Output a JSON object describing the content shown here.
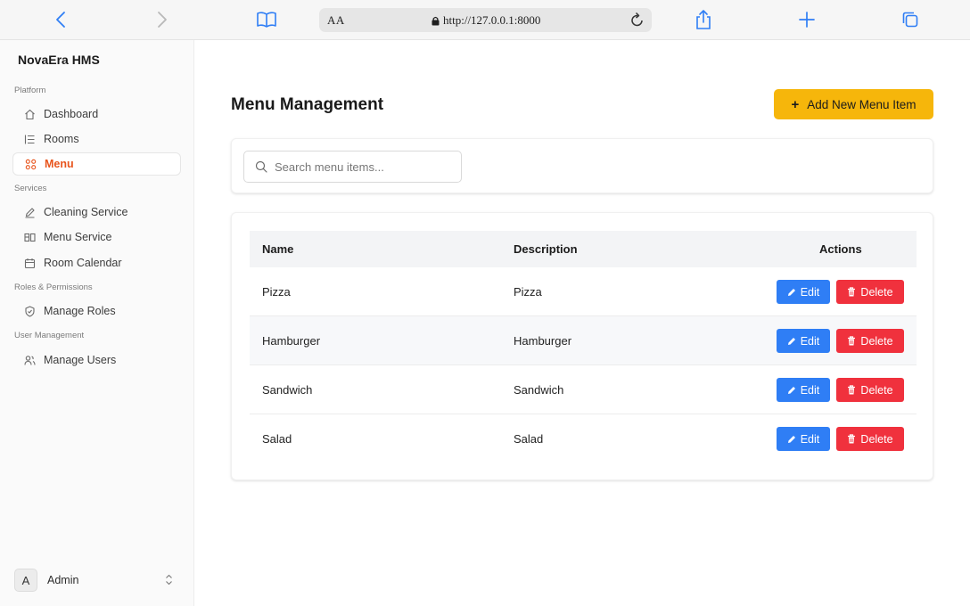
{
  "browser": {
    "text_size_label": "AA",
    "url": "http://127.0.0.1:8000"
  },
  "sidebar": {
    "brand": "NovaEra HMS",
    "sections": [
      {
        "label": "Platform",
        "items": [
          {
            "label": "Dashboard",
            "icon": "home-icon"
          },
          {
            "label": "Rooms",
            "icon": "list-icon"
          },
          {
            "label": "Menu",
            "icon": "grid-icon",
            "active": true
          }
        ]
      },
      {
        "label": "Services",
        "items": [
          {
            "label": "Cleaning Service",
            "icon": "pencil-icon"
          },
          {
            "label": "Menu Service",
            "icon": "panels-icon"
          },
          {
            "label": "Room Calendar",
            "icon": "calendar-icon"
          }
        ]
      },
      {
        "label": "Roles & Permissions",
        "items": [
          {
            "label": "Manage Roles",
            "icon": "shield-icon"
          }
        ]
      },
      {
        "label": "User Management",
        "items": [
          {
            "label": "Manage Users",
            "icon": "users-icon"
          }
        ]
      }
    ],
    "user": {
      "initial": "A",
      "name": "Admin"
    }
  },
  "main": {
    "title": "Menu Management",
    "add_button": {
      "plus": "+",
      "label": "Add New Menu Item"
    },
    "search": {
      "placeholder": "Search menu items..."
    },
    "table": {
      "headers": {
        "name": "Name",
        "description": "Description",
        "actions": "Actions"
      },
      "rows": [
        {
          "name": "Pizza",
          "description": "Pizza"
        },
        {
          "name": "Hamburger",
          "description": "Hamburger"
        },
        {
          "name": "Sandwich",
          "description": "Sandwich"
        },
        {
          "name": "Salad",
          "description": "Salad"
        }
      ],
      "edit_label": "Edit",
      "delete_label": "Delete"
    }
  },
  "colors": {
    "accent": "#e8541c",
    "add_button": "#f6b60b",
    "edit_button": "#2f7ef5",
    "delete_button": "#f0313d"
  }
}
